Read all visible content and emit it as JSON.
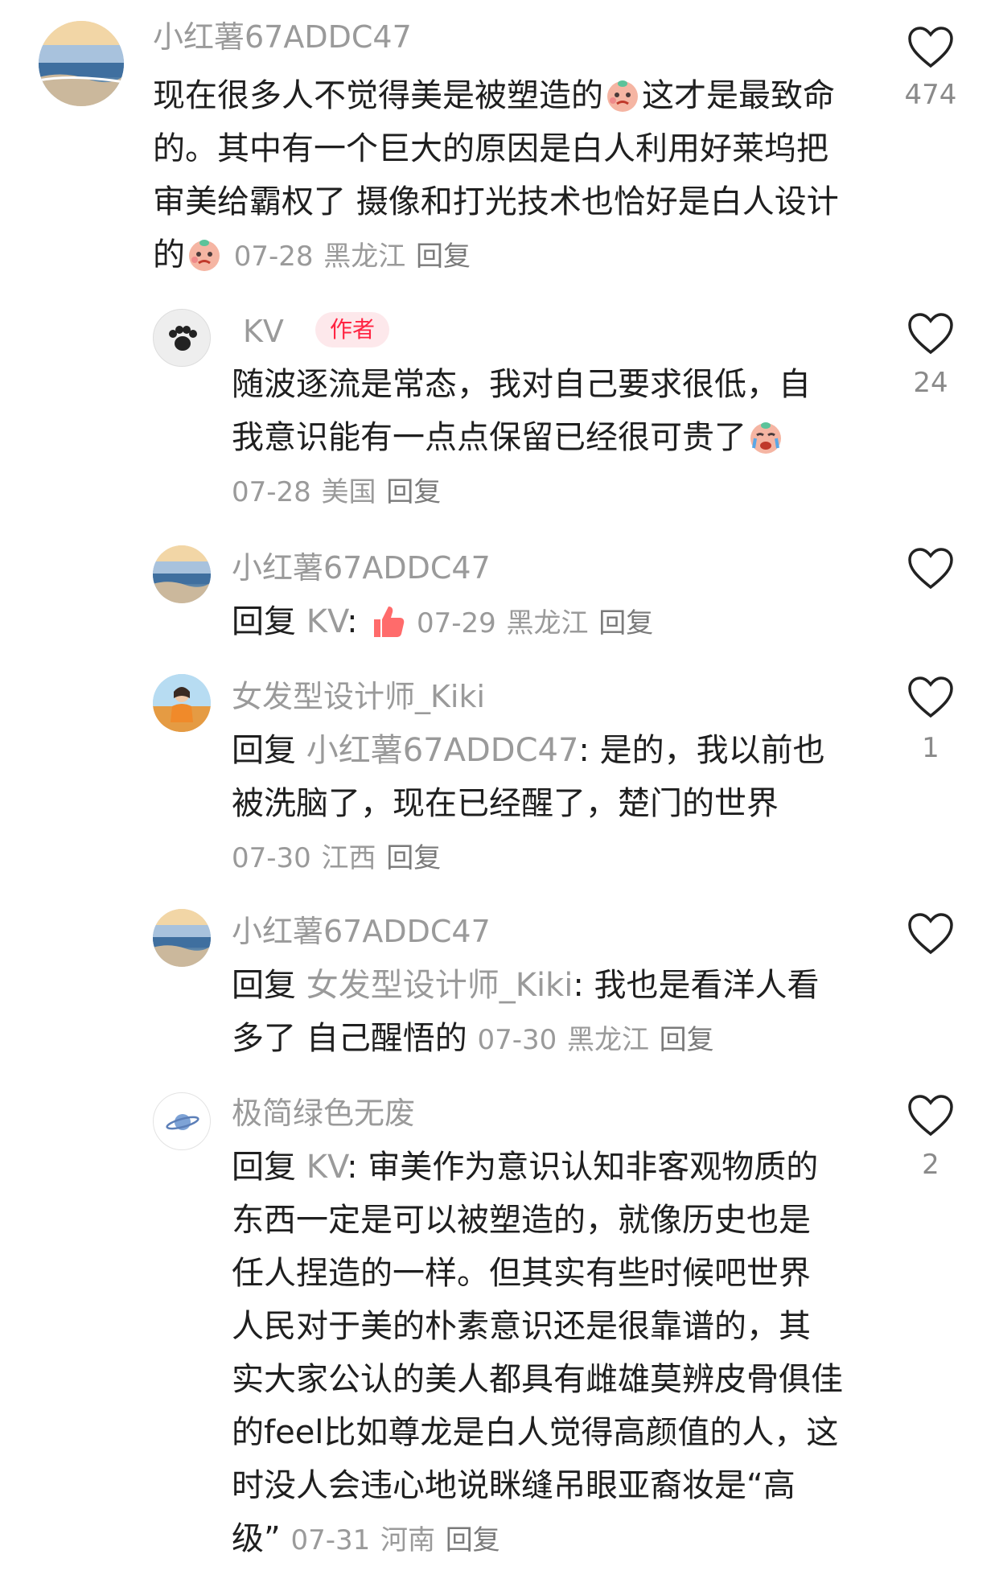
{
  "comments": [
    {
      "username": "小红薯67ADDC47",
      "text_part1": "现在很多人不觉得美是被塑造的",
      "text_part2": "这才是最致命",
      "text_line2": "的。其中有一个巨大的原因是白人利用好莱坞把",
      "text_line3": "审美给霸权了 摄像和打光技术也恰好是白人设计",
      "text_line4": "的",
      "date": "07-28",
      "location": "黑龙江",
      "reply_label": "回复",
      "likes": "474",
      "avatar_icon": "sea-avatar"
    },
    {
      "username": "KV",
      "badge": "作者",
      "text_line1": "随波逐流是常态，我对自己要求很低，自",
      "text_line2": "我意识能有一点点保留已经很可贵了",
      "date": "07-28",
      "location": "美国",
      "reply_label": "回复",
      "likes": "24",
      "avatar_icon": "paw-avatar"
    },
    {
      "username": "小红薯67ADDC47",
      "reply_prefix": "回复",
      "reply_target": "KV",
      "colon": ":",
      "date": "07-29",
      "location": "黑龙江",
      "reply_label": "回复",
      "likes": "",
      "avatar_icon": "sea-avatar"
    },
    {
      "username": "女发型设计师_Kiki",
      "reply_prefix": "回复",
      "reply_target": "小红薯67ADDC47",
      "text_part1": ": 是的，我以前也",
      "text_line2": "被洗脑了，现在已经醒了，楚门的世界",
      "date": "07-30",
      "location": "江西",
      "reply_label": "回复",
      "likes": "1",
      "avatar_icon": "girl-avatar"
    },
    {
      "username": "小红薯67ADDC47",
      "reply_prefix": "回复",
      "reply_target": "女发型设计师_Kiki",
      "text_part1": ": 我也是看洋人看",
      "text_line2": "多了 自己醒悟的",
      "date": "07-30",
      "location": "黑龙江",
      "reply_label": "回复",
      "likes": "",
      "avatar_icon": "sea-avatar"
    },
    {
      "username": "极简绿色无废",
      "reply_prefix": "回复",
      "reply_target": "KV",
      "text_part1": ": 审美作为意识认知非客观物质的",
      "text_line2": "东西一定是可以被塑造的，就像历史也是",
      "text_line3": "任人捏造的一样。但其实有些时候吧世界",
      "text_line4": "人民对于美的朴素意识还是很靠谱的，其",
      "text_line5": "实大家公认的美人都具有雌雄莫辨皮骨俱佳",
      "text_line6": "的feel比如尊龙是白人觉得高颜值的人，这",
      "text_line7": "时没人会违心地说眯缝吊眼亚裔妆是“高",
      "text_line8": "级”",
      "date": "07-31",
      "location": "河南",
      "reply_label": "回复",
      "likes": "2",
      "avatar_icon": "planet-avatar"
    }
  ],
  "colors": {
    "badge_text": "#ff2442",
    "badge_bg": "#fde8eb",
    "muted": "#9a9a9a"
  }
}
